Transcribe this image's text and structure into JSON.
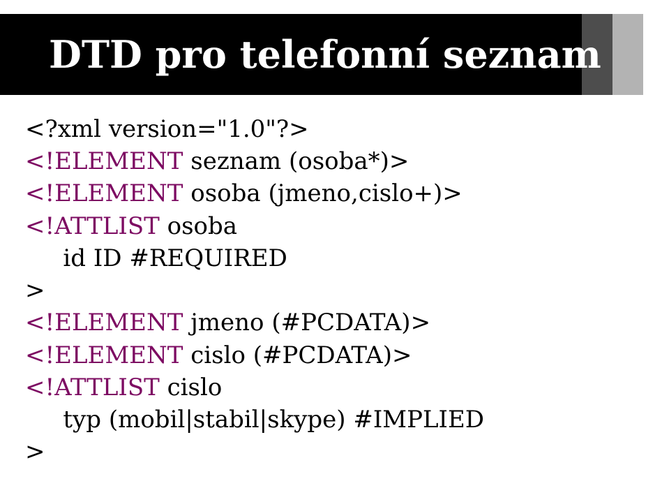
{
  "title": "DTD pro telefonní seznam",
  "code": {
    "xmlDecl": "<?xml version=\"1.0\"?>",
    "l2_kw": "<!ELEMENT",
    "l2_name": " seznam ",
    "l2_rest": "(osoba*)>",
    "l3_kw": "<!ELEMENT",
    "l3_name": " osoba ",
    "l3_rest": "(jmeno,cislo+)>",
    "l4_kw": "<!ATTLIST",
    "l4_name": " osoba",
    "l5": "id ID #REQUIRED",
    "l6": ">",
    "l7_kw": "<!ELEMENT",
    "l7_name": " jmeno ",
    "l7_rest": "(#PCDATA)>",
    "l8_kw": "<!ELEMENT",
    "l8_name": " cislo ",
    "l8_rest": "(#PCDATA)>",
    "l9_kw": "<!ATTLIST",
    "l9_name": " cislo",
    "l10": "typ (mobil|stabil|skype) #IMPLIED",
    "l11": ">"
  }
}
